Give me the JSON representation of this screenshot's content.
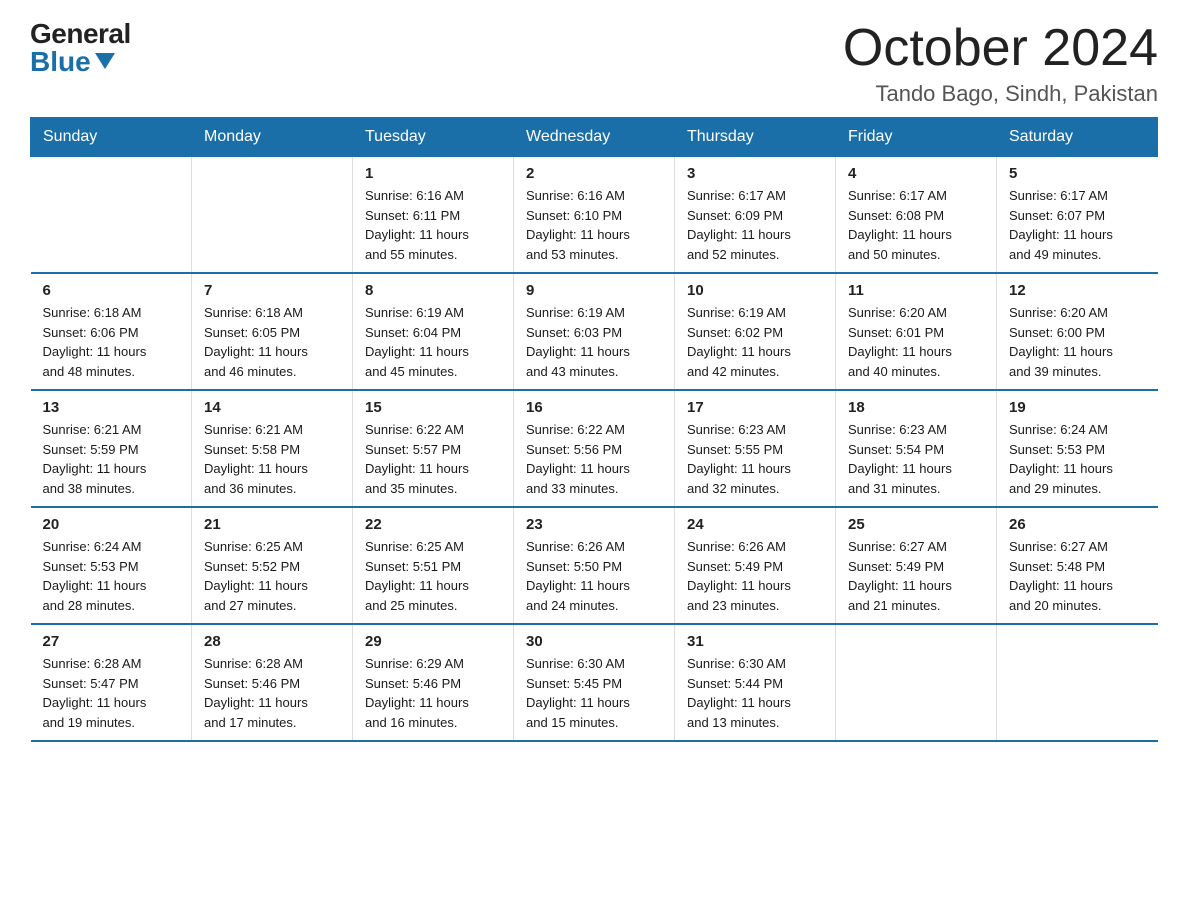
{
  "header": {
    "logo_general": "General",
    "logo_blue": "Blue",
    "title": "October 2024",
    "subtitle": "Tando Bago, Sindh, Pakistan"
  },
  "columns": [
    "Sunday",
    "Monday",
    "Tuesday",
    "Wednesday",
    "Thursday",
    "Friday",
    "Saturday"
  ],
  "weeks": [
    [
      {
        "day": "",
        "info": ""
      },
      {
        "day": "",
        "info": ""
      },
      {
        "day": "1",
        "info": "Sunrise: 6:16 AM\nSunset: 6:11 PM\nDaylight: 11 hours\nand 55 minutes."
      },
      {
        "day": "2",
        "info": "Sunrise: 6:16 AM\nSunset: 6:10 PM\nDaylight: 11 hours\nand 53 minutes."
      },
      {
        "day": "3",
        "info": "Sunrise: 6:17 AM\nSunset: 6:09 PM\nDaylight: 11 hours\nand 52 minutes."
      },
      {
        "day": "4",
        "info": "Sunrise: 6:17 AM\nSunset: 6:08 PM\nDaylight: 11 hours\nand 50 minutes."
      },
      {
        "day": "5",
        "info": "Sunrise: 6:17 AM\nSunset: 6:07 PM\nDaylight: 11 hours\nand 49 minutes."
      }
    ],
    [
      {
        "day": "6",
        "info": "Sunrise: 6:18 AM\nSunset: 6:06 PM\nDaylight: 11 hours\nand 48 minutes."
      },
      {
        "day": "7",
        "info": "Sunrise: 6:18 AM\nSunset: 6:05 PM\nDaylight: 11 hours\nand 46 minutes."
      },
      {
        "day": "8",
        "info": "Sunrise: 6:19 AM\nSunset: 6:04 PM\nDaylight: 11 hours\nand 45 minutes."
      },
      {
        "day": "9",
        "info": "Sunrise: 6:19 AM\nSunset: 6:03 PM\nDaylight: 11 hours\nand 43 minutes."
      },
      {
        "day": "10",
        "info": "Sunrise: 6:19 AM\nSunset: 6:02 PM\nDaylight: 11 hours\nand 42 minutes."
      },
      {
        "day": "11",
        "info": "Sunrise: 6:20 AM\nSunset: 6:01 PM\nDaylight: 11 hours\nand 40 minutes."
      },
      {
        "day": "12",
        "info": "Sunrise: 6:20 AM\nSunset: 6:00 PM\nDaylight: 11 hours\nand 39 minutes."
      }
    ],
    [
      {
        "day": "13",
        "info": "Sunrise: 6:21 AM\nSunset: 5:59 PM\nDaylight: 11 hours\nand 38 minutes."
      },
      {
        "day": "14",
        "info": "Sunrise: 6:21 AM\nSunset: 5:58 PM\nDaylight: 11 hours\nand 36 minutes."
      },
      {
        "day": "15",
        "info": "Sunrise: 6:22 AM\nSunset: 5:57 PM\nDaylight: 11 hours\nand 35 minutes."
      },
      {
        "day": "16",
        "info": "Sunrise: 6:22 AM\nSunset: 5:56 PM\nDaylight: 11 hours\nand 33 minutes."
      },
      {
        "day": "17",
        "info": "Sunrise: 6:23 AM\nSunset: 5:55 PM\nDaylight: 11 hours\nand 32 minutes."
      },
      {
        "day": "18",
        "info": "Sunrise: 6:23 AM\nSunset: 5:54 PM\nDaylight: 11 hours\nand 31 minutes."
      },
      {
        "day": "19",
        "info": "Sunrise: 6:24 AM\nSunset: 5:53 PM\nDaylight: 11 hours\nand 29 minutes."
      }
    ],
    [
      {
        "day": "20",
        "info": "Sunrise: 6:24 AM\nSunset: 5:53 PM\nDaylight: 11 hours\nand 28 minutes."
      },
      {
        "day": "21",
        "info": "Sunrise: 6:25 AM\nSunset: 5:52 PM\nDaylight: 11 hours\nand 27 minutes."
      },
      {
        "day": "22",
        "info": "Sunrise: 6:25 AM\nSunset: 5:51 PM\nDaylight: 11 hours\nand 25 minutes."
      },
      {
        "day": "23",
        "info": "Sunrise: 6:26 AM\nSunset: 5:50 PM\nDaylight: 11 hours\nand 24 minutes."
      },
      {
        "day": "24",
        "info": "Sunrise: 6:26 AM\nSunset: 5:49 PM\nDaylight: 11 hours\nand 23 minutes."
      },
      {
        "day": "25",
        "info": "Sunrise: 6:27 AM\nSunset: 5:49 PM\nDaylight: 11 hours\nand 21 minutes."
      },
      {
        "day": "26",
        "info": "Sunrise: 6:27 AM\nSunset: 5:48 PM\nDaylight: 11 hours\nand 20 minutes."
      }
    ],
    [
      {
        "day": "27",
        "info": "Sunrise: 6:28 AM\nSunset: 5:47 PM\nDaylight: 11 hours\nand 19 minutes."
      },
      {
        "day": "28",
        "info": "Sunrise: 6:28 AM\nSunset: 5:46 PM\nDaylight: 11 hours\nand 17 minutes."
      },
      {
        "day": "29",
        "info": "Sunrise: 6:29 AM\nSunset: 5:46 PM\nDaylight: 11 hours\nand 16 minutes."
      },
      {
        "day": "30",
        "info": "Sunrise: 6:30 AM\nSunset: 5:45 PM\nDaylight: 11 hours\nand 15 minutes."
      },
      {
        "day": "31",
        "info": "Sunrise: 6:30 AM\nSunset: 5:44 PM\nDaylight: 11 hours\nand 13 minutes."
      },
      {
        "day": "",
        "info": ""
      },
      {
        "day": "",
        "info": ""
      }
    ]
  ]
}
